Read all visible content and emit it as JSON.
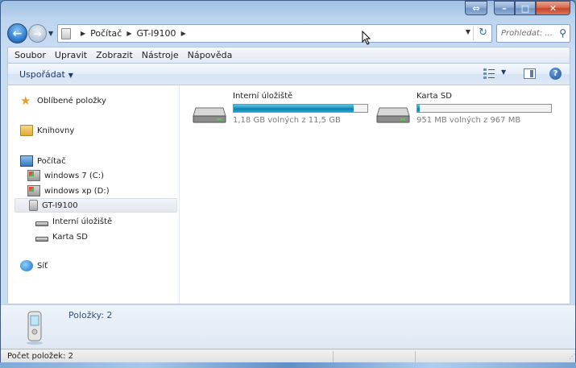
{
  "address": {
    "crumbs": [
      "Počítač",
      "GT-I9100"
    ],
    "search_placeholder": "Prohledat: ..."
  },
  "menubar": {
    "items": [
      "Soubor",
      "Upravit",
      "Zobrazit",
      "Nástroje",
      "Nápověda"
    ]
  },
  "commandbar": {
    "organize": "Uspořádat"
  },
  "sidebar": {
    "favorites": "Oblíbené položky",
    "libraries": "Knihovny",
    "computer": "Počítač",
    "drive_c": "windows 7 (C:)",
    "drive_d": "windows xp (D:)",
    "device": "GT-I9100",
    "internal": "Interní úložiště",
    "sdcard": "Karta SD",
    "network": "Síť"
  },
  "drives": [
    {
      "name": "Interní úložiště",
      "free_text": "1,18 GB volných z 11,5 GB",
      "used_fraction": 0.897
    },
    {
      "name": "Karta SD",
      "free_text": "951 MB volných z 967 MB",
      "used_fraction": 0.017
    }
  ],
  "details": {
    "items_count": "Položky: 2"
  },
  "statusbar": {
    "text": "Počet položek: 2"
  },
  "colors": {
    "bar_fill": "#1f95bf",
    "window_frame": "#9fc0e4",
    "close_button": "#c7452a"
  }
}
